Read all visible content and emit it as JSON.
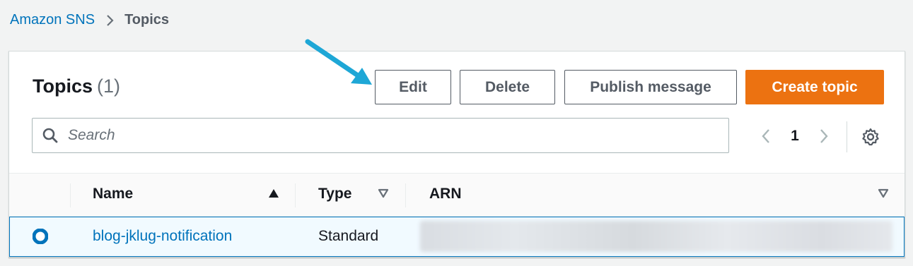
{
  "breadcrumb": {
    "root": "Amazon SNS",
    "current": "Topics"
  },
  "header": {
    "title": "Topics",
    "count": "(1)"
  },
  "actions": {
    "edit": "Edit",
    "delete": "Delete",
    "publish": "Publish message",
    "create": "Create topic"
  },
  "search": {
    "placeholder": "Search"
  },
  "pagination": {
    "current_page": "1"
  },
  "table": {
    "columns": [
      "Name",
      "Type",
      "ARN"
    ],
    "sort": {
      "column": "Name",
      "direction": "ascending"
    },
    "rows": [
      {
        "name": "blog-jklug-notification",
        "type": "Standard",
        "arn": "",
        "selected": true
      }
    ]
  },
  "colors": {
    "link": "#0073bb",
    "primary_button": "#ec7211",
    "annotation_arrow": "#1ea7d6",
    "selected_row_bg": "#f1faff"
  },
  "icons": [
    "chevron-right-icon",
    "search-icon",
    "chevron-left-icon",
    "settings-gear-icon",
    "sort-ascending-icon",
    "sort-descending-icon",
    "radio-selected-icon",
    "annotation-arrow-icon"
  ]
}
